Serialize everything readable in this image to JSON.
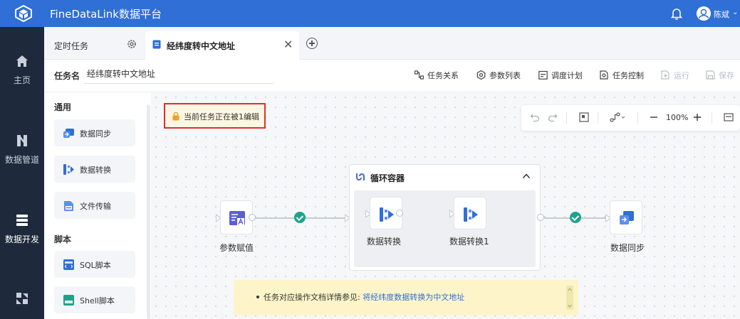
{
  "app": {
    "title": "FineDataLink数据平台"
  },
  "user": {
    "name": "陈斌"
  },
  "nav": [
    {
      "label": "主页",
      "icon": "home-icon"
    },
    {
      "label": "数据管道",
      "icon": "pipeline-icon"
    },
    {
      "label": "数据开发",
      "icon": "dev-icon",
      "active": true
    },
    {
      "label": "",
      "icon": "ops-icon"
    }
  ],
  "tabs": [
    {
      "label": "定时任务"
    },
    {
      "label": "经纬度转中文地址",
      "active": true
    }
  ],
  "task": {
    "name_label": "任务名",
    "name_value": "经纬度转中文地址"
  },
  "toolbar": {
    "relation": "任务关系",
    "params": "参数列表",
    "schedule": "调度计划",
    "control": "任务控制",
    "run": "运行",
    "save": "保存"
  },
  "panel": {
    "general_title": "通用",
    "general_items": [
      "数据同步",
      "数据转换",
      "文件传输"
    ],
    "script_title": "脚本",
    "script_items": [
      "SQL脚本",
      "Shell脚本"
    ]
  },
  "lock": {
    "text": "当前任务正在被1编辑"
  },
  "canvas_toolbar": {
    "zoom": "100%"
  },
  "flow": {
    "container_title": "循环容器",
    "nodes": {
      "assign": "参数赋值",
      "convert": "数据转换",
      "convert1": "数据转换1",
      "sync": "数据同步"
    }
  },
  "tip": {
    "text": "任务对应操作文档详情参见: ",
    "link": "将经纬度数据转换为中文地址"
  },
  "colors": {
    "brand": "#2f6fd6",
    "nav_bg": "#1e2a3b",
    "success": "#1ea38a",
    "lock_border": "#e0302a",
    "node_icon": "#5b5fd6"
  }
}
